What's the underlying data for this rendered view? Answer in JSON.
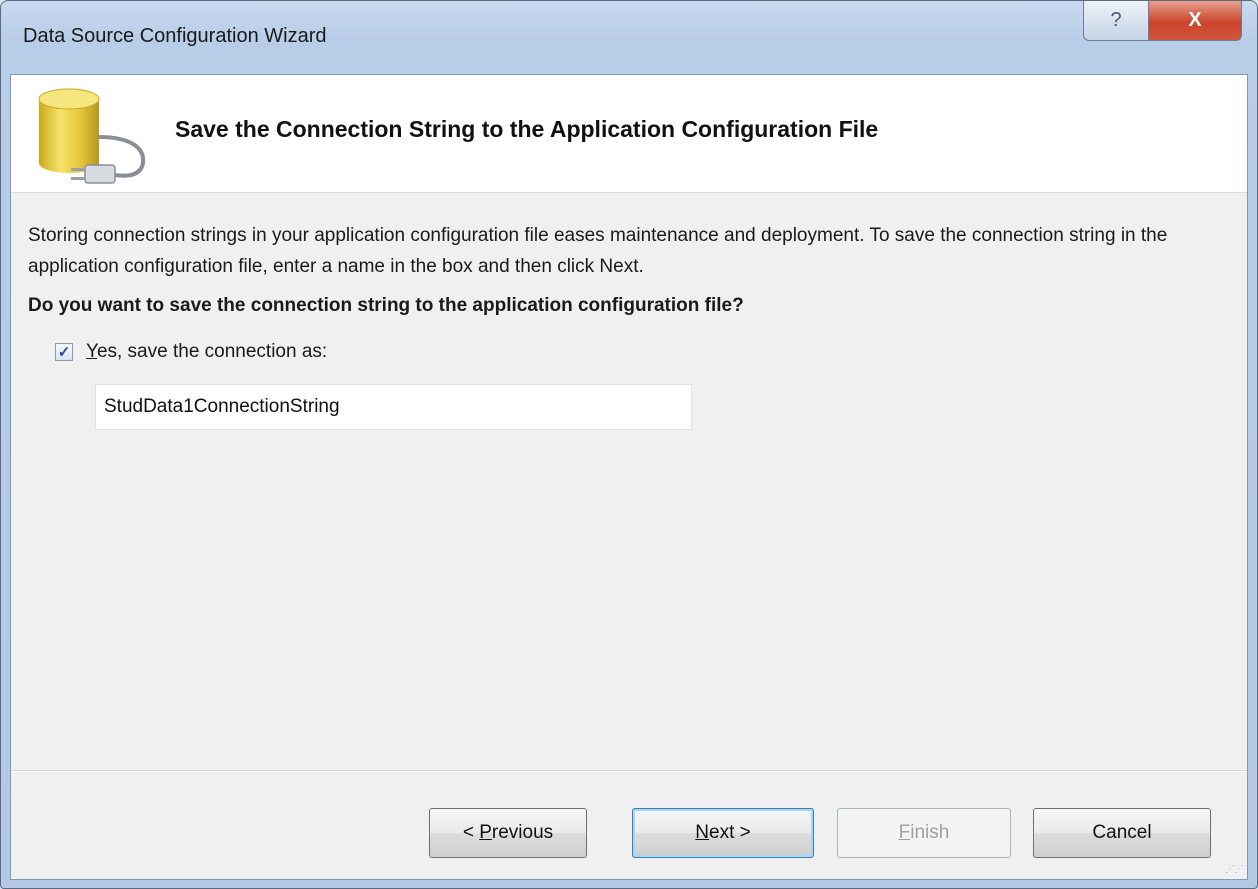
{
  "window": {
    "title": "Data Source Configuration Wizard",
    "help_glyph": "?",
    "close_glyph": "X"
  },
  "header": {
    "icon": "database-plug-icon",
    "title": "Save the Connection String to the Application Configuration File"
  },
  "body": {
    "description": "Storing connection strings in your application configuration file eases maintenance and deployment. To save the connection string in the application configuration file, enter a name in the box and then click Next.",
    "question": "Do you want to save the connection string to the application configuration file?",
    "checkbox": {
      "checked": true,
      "mnemonic": "Y",
      "label_rest": "es, save the connection as:"
    },
    "connection_name": "StudData1ConnectionString"
  },
  "buttons": {
    "previous": {
      "pre": "< ",
      "mnemonic": "P",
      "post": "revious"
    },
    "next": {
      "mnemonic": "N",
      "post": "ext >"
    },
    "finish": {
      "mnemonic": "F",
      "post": "inish",
      "enabled": false
    },
    "cancel": "Cancel"
  },
  "colors": {
    "close_button": "#c9442b",
    "header_background": "#ffffff",
    "client_background": "#f0f0f0"
  }
}
